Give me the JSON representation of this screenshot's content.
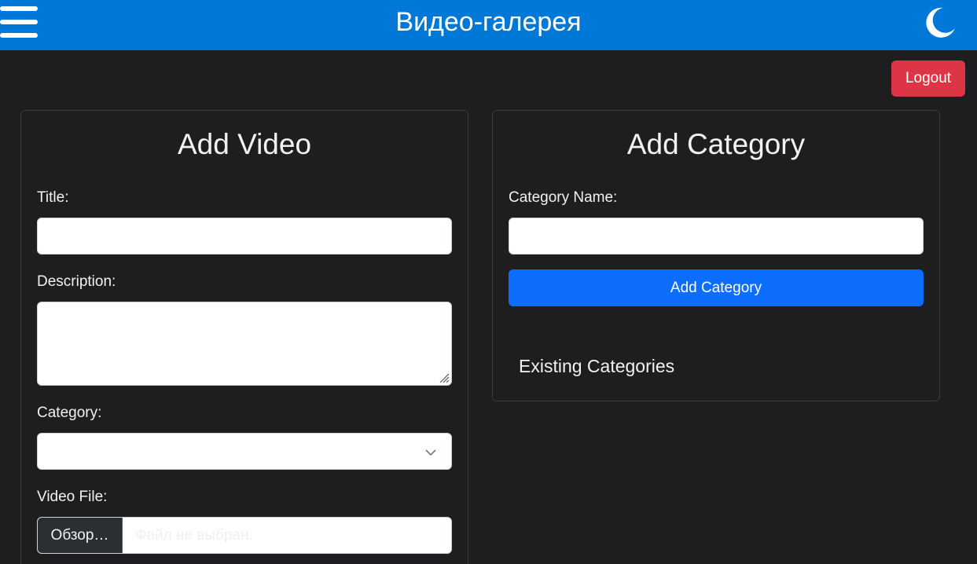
{
  "header": {
    "title": "Видео-галерея",
    "menu_icon": "hamburger-icon",
    "theme_icon": "moon-icon",
    "background": "#0078d7"
  },
  "logout": {
    "label": "Logout",
    "color": "#dc3545"
  },
  "add_video": {
    "title": "Add Video",
    "title_label": "Title:",
    "title_value": "",
    "description_label": "Description:",
    "description_value": "",
    "category_label": "Category:",
    "category_value": "",
    "file_label": "Video File:",
    "file_button": "Обзор…",
    "file_status": "Файл не выбран."
  },
  "add_category": {
    "title": "Add Category",
    "name_label": "Category Name:",
    "name_value": "",
    "button": "Add Category",
    "button_color": "#0d6efd",
    "existing_heading": "Existing Categories"
  }
}
